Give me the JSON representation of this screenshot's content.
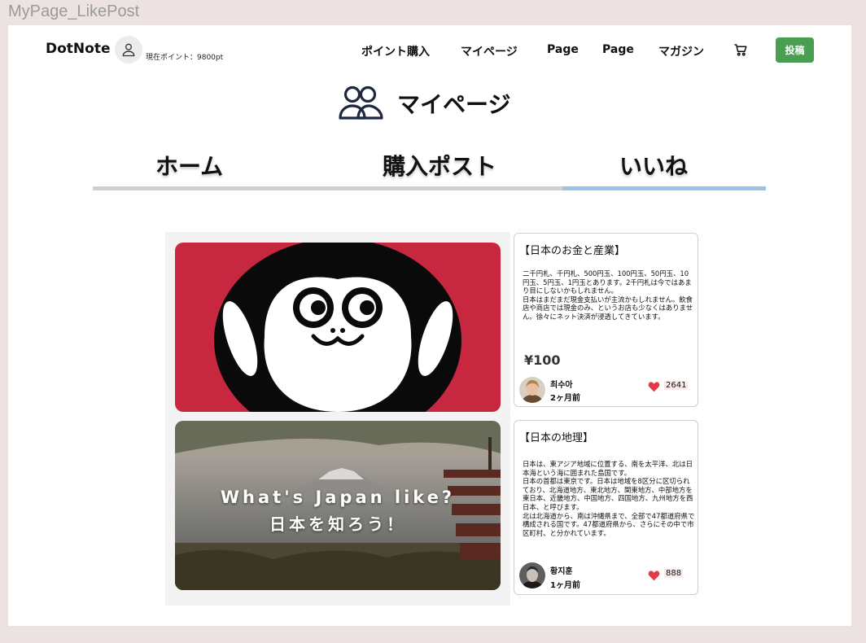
{
  "frame": {
    "label": "MyPage_LikePost"
  },
  "header": {
    "logo": "DotNote",
    "points_text": "現在ポイント：9800pt",
    "nav": [
      "ポイント購入",
      "マイページ",
      "Page",
      "Page",
      "マガジン"
    ],
    "post_button": "投稿"
  },
  "page": {
    "title": "マイページ"
  },
  "tabs": [
    {
      "label": "ホーム",
      "active": false
    },
    {
      "label": "購入ポスト",
      "active": false
    },
    {
      "label": "いいね",
      "active": true
    }
  ],
  "posts": [
    {
      "thumbnail": "monkey-illustration",
      "title": "【日本のお金と産業】",
      "body": "二千円札、千円札、500円玉、100円玉、50円玉、10円玉、5円玉、1円玉とあります。2千円札は今ではあまり目にしないかもしれません。\n日本はまだまだ現金支払いが主流かもしれません。飲食店や商店では現金のみ、というお店も少なくはありません。徐々にネット決済が浸透してきています。",
      "price": "¥100",
      "author": "최수아",
      "time": "2ヶ月前",
      "likes": "2641"
    },
    {
      "thumbnail": "japan-landscape",
      "banner_line1": "What's Japan like?",
      "banner_line2": "日本を知ろう！",
      "title": "【日本の地理】",
      "body": "日本は、東アジア地域に位置する、南を太平洋、北は日本海という海に囲まれた島国です。\n日本の首都は東京です。日本は地域を8区分に区切られており、北海道地方、東北地方、関東地方、中部地方を東日本、近畿地方、中国地方、四国地方、九州地方を西日本、と呼びます。\n北は北海道から、南は沖縄県まで、全部で47都道府県で構成される国です。47都道府県から、さらにその中で市区町村、と分かれています。",
      "author": "황지훈",
      "time": "1ヶ月前",
      "likes": "888"
    }
  ],
  "colors": {
    "accent_green": "#4a9e52",
    "active_tab": "#9cc4e6",
    "heart": "#e53945",
    "thumb_red": "#c8283f"
  },
  "icons": {
    "user": "user-icon",
    "cart": "cart-icon",
    "users": "users-icon",
    "heart": "heart-icon"
  }
}
